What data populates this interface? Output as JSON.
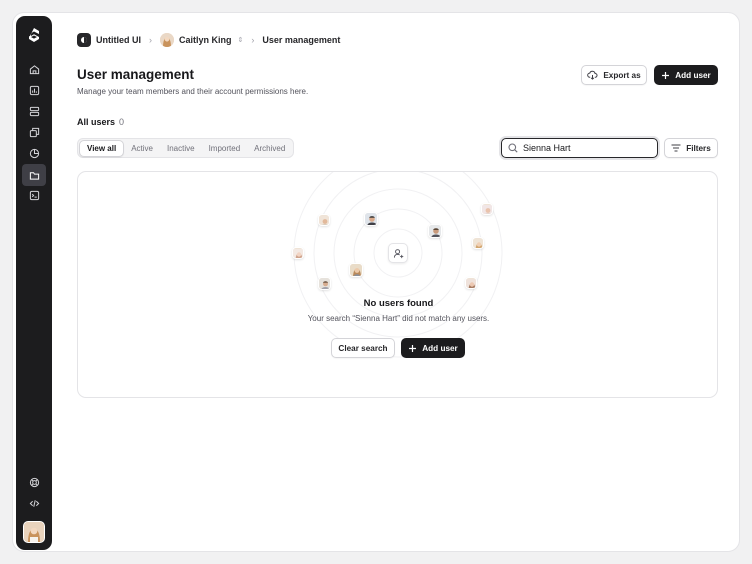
{
  "breadcrumb": {
    "workspace": "Untitled UI",
    "user": "Caitlyn King",
    "page": "User management"
  },
  "header": {
    "title": "User management",
    "subtitle": "Manage your team members and their account permissions here.",
    "export_label": "Export as",
    "add_user_label": "Add user"
  },
  "users": {
    "label": "All users",
    "count": "0"
  },
  "tabs": [
    {
      "label": "View all",
      "active": true
    },
    {
      "label": "Active"
    },
    {
      "label": "Inactive"
    },
    {
      "label": "Imported"
    },
    {
      "label": "Archived"
    }
  ],
  "search": {
    "value": "Sienna Hart"
  },
  "filters_label": "Filters",
  "empty_state": {
    "title": "No users found",
    "message": "Your search “Sienna Hart” did not match any users.",
    "clear_label": "Clear search",
    "add_label": "Add user"
  },
  "sidebar": {
    "icons": [
      "home-icon",
      "bar-chart-icon",
      "layers-icon",
      "copy-icon",
      "pie-chart-icon",
      "folder-icon",
      "terminal-icon",
      "support-icon",
      "code-icon"
    ],
    "active": "folder-icon"
  },
  "colors": {
    "dark": "#1c1c1e",
    "border": "#e4e4e7",
    "muted": "#71717a"
  }
}
